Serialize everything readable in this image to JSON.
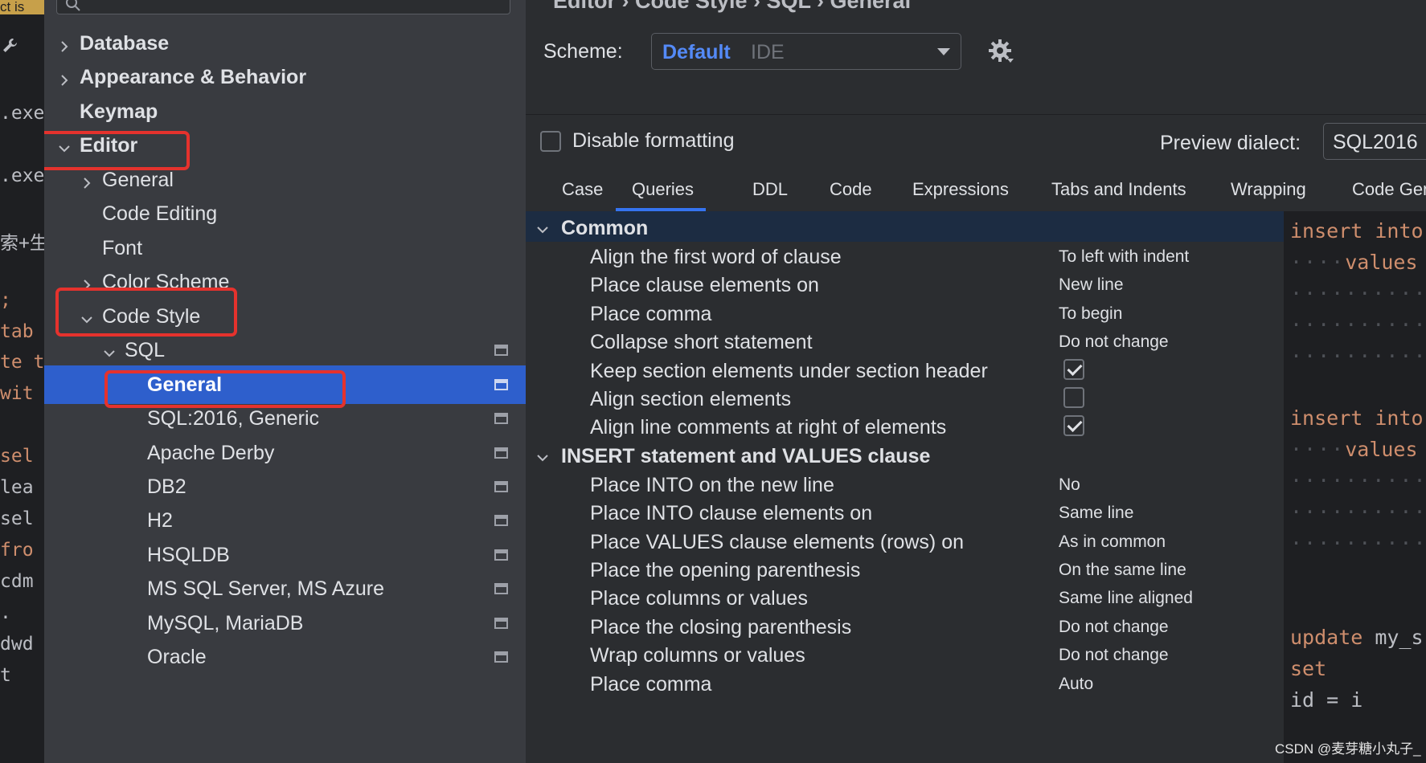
{
  "left_strip": {
    "top_chip": "ct is",
    "lines": [
      {
        "text": ".exe",
        "kw": false
      },
      {
        "text": ".exe",
        "kw": false
      },
      {
        "text": "索+生",
        "kw": false
      },
      {
        "text": ";",
        "kw": true
      },
      {
        "text": " tab",
        "kw": true
      },
      {
        "text": "te t",
        "kw": true
      },
      {
        "text": " wit",
        "kw": true
      },
      {
        "text": " sel",
        "kw": true
      },
      {
        "text": " lea",
        "kw": false
      },
      {
        "text": " sel",
        "kw": false
      },
      {
        "text": " fro",
        "kw": true
      },
      {
        "text": " cdm",
        "kw": false
      },
      {
        "text": " .",
        "kw": false
      },
      {
        "text": " dwd",
        "kw": false
      },
      {
        "text": " t",
        "kw": false
      }
    ]
  },
  "tree": {
    "items": [
      {
        "label": "Database",
        "chevron": "right",
        "bold": true
      },
      {
        "label": "Appearance & Behavior",
        "chevron": "right",
        "bold": true
      },
      {
        "label": "Keymap",
        "chevron": "none",
        "bold": true
      },
      {
        "label": "Editor",
        "chevron": "down",
        "bold": true
      },
      {
        "label": "General",
        "chevron": "right",
        "bold": false
      },
      {
        "label": "Code Editing",
        "chevron": "none",
        "bold": false
      },
      {
        "label": "Font",
        "chevron": "none",
        "bold": false
      },
      {
        "label": "Color Scheme",
        "chevron": "right",
        "bold": false
      },
      {
        "label": "Code Style",
        "chevron": "down",
        "bold": false
      },
      {
        "label": "SQL",
        "chevron": "down",
        "bold": false
      },
      {
        "label": "General",
        "chevron": "none",
        "bold": true,
        "selected": true
      },
      {
        "label": "SQL:2016, Generic",
        "chevron": "none",
        "bold": false
      },
      {
        "label": "Apache Derby",
        "chevron": "none",
        "bold": false
      },
      {
        "label": "DB2",
        "chevron": "none",
        "bold": false
      },
      {
        "label": "H2",
        "chevron": "none",
        "bold": false
      },
      {
        "label": "HSQLDB",
        "chevron": "none",
        "bold": false
      },
      {
        "label": "MS SQL Server, MS Azure",
        "chevron": "none",
        "bold": false
      },
      {
        "label": "MySQL, MariaDB",
        "chevron": "none",
        "bold": false
      },
      {
        "label": "Oracle",
        "chevron": "none",
        "bold": false
      }
    ]
  },
  "header": {
    "breadcrumb": "Editor  ›  Code Style  ›  SQL  ›  General",
    "scheme_label": "Scheme:",
    "scheme_name": "Default",
    "scheme_scope": "IDE"
  },
  "formatting": {
    "disable_label": "Disable formatting",
    "disable_checked": false,
    "preview_dialect_label": "Preview dialect:",
    "preview_dialect_value": "SQL2016"
  },
  "tabs": [
    {
      "label": "Case",
      "active": false
    },
    {
      "label": "Queries",
      "active": true
    },
    {
      "label": "DDL",
      "active": false
    },
    {
      "label": "Code",
      "active": false
    },
    {
      "label": "Expressions",
      "active": false
    },
    {
      "label": "Tabs and Indents",
      "active": false
    },
    {
      "label": "Wrapping",
      "active": false
    },
    {
      "label": "Code Gen",
      "active": false
    }
  ],
  "sections": [
    {
      "title": "Common",
      "options": [
        {
          "name": "Align the first word of clause",
          "value": "To left with indent"
        },
        {
          "name": "Place clause elements on",
          "value": "New line"
        },
        {
          "name": "Place comma",
          "value": "To begin"
        },
        {
          "name": "Collapse short statement",
          "value": "Do not change"
        },
        {
          "name": "Keep section elements under section header",
          "checkbox": true,
          "checked": true
        },
        {
          "name": "Align section elements",
          "checkbox": true,
          "checked": false
        },
        {
          "name": "Align line comments at right of elements",
          "checkbox": true,
          "checked": true
        }
      ]
    },
    {
      "title": "INSERT statement and VALUES clause",
      "options": [
        {
          "name": "Place INTO on the new line",
          "value": "No"
        },
        {
          "name": "Place INTO clause elements on",
          "value": "Same line"
        },
        {
          "name": "Place VALUES clause elements (rows) on",
          "value": "As in common"
        },
        {
          "name": "Place the opening parenthesis",
          "value": "On the same line"
        },
        {
          "name": "Place columns or values",
          "value": "Same line aligned"
        },
        {
          "name": "Place the closing parenthesis",
          "value": "Do not change"
        },
        {
          "name": "Wrap columns or values",
          "value": "Do not change"
        },
        {
          "name": "Place comma",
          "value": "Auto"
        }
      ]
    }
  ],
  "preview": {
    "lines": [
      {
        "dots": "",
        "kw": "insert into",
        "rest": ""
      },
      {
        "dots": "····",
        "kw": "values",
        "rest": ""
      },
      {
        "dots": "··········",
        "kw": "",
        "rest": "("
      },
      {
        "dots": "··········",
        "kw": "",
        "rest": "("
      },
      {
        "dots": "··········",
        "kw": "",
        "rest": "("
      },
      {
        "dots": "",
        "kw": "",
        "rest": ""
      },
      {
        "dots": "",
        "kw": "insert into",
        "rest": ""
      },
      {
        "dots": "····",
        "kw": "values",
        "rest": ""
      },
      {
        "dots": "··········",
        "kw": "",
        "rest": "("
      },
      {
        "dots": "··········",
        "kw": "",
        "rest": ""
      },
      {
        "dots": "··········",
        "kw": "",
        "rest": ""
      },
      {
        "dots": "",
        "kw": "",
        "rest": ""
      },
      {
        "dots": "",
        "kw": "",
        "rest": ""
      },
      {
        "dots": "",
        "kw": "update",
        "rest": " my_s"
      },
      {
        "dots": "",
        "kw": "set",
        "rest": ""
      },
      {
        "dots": "",
        "kw": "",
        "rest": "id = i"
      }
    ]
  },
  "watermark": "CSDN @麦芽糖小丸子_"
}
